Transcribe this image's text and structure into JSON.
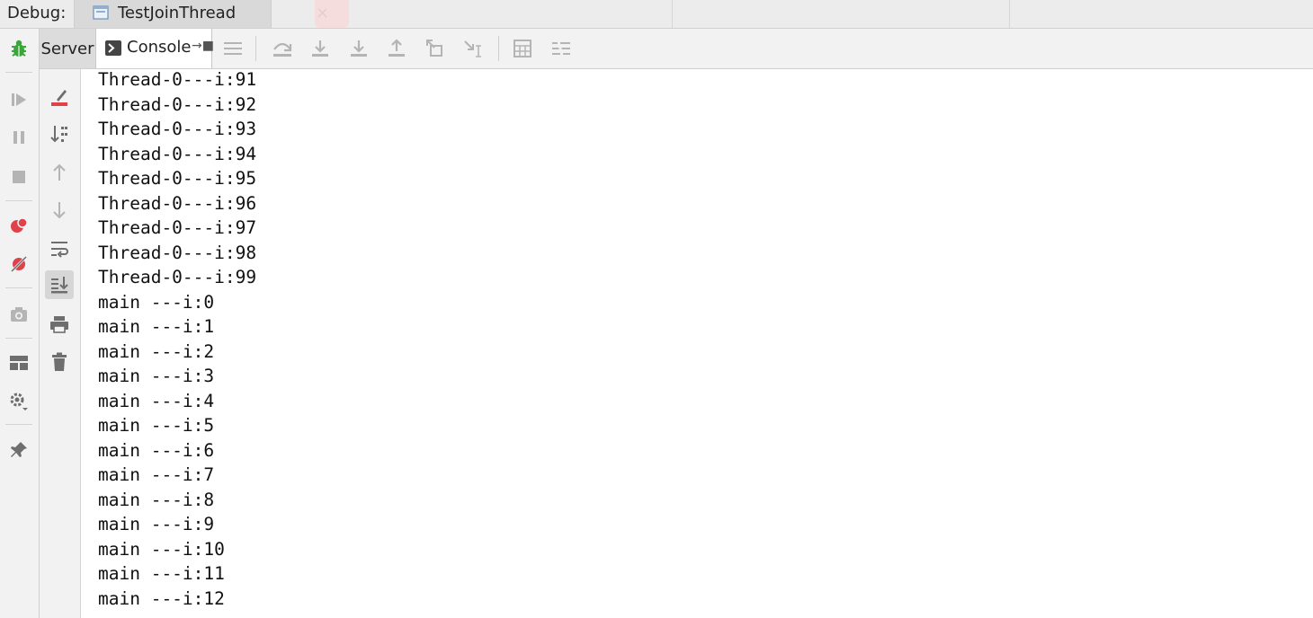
{
  "header": {
    "debug_label": "Debug:",
    "tab_label": "TestJoinThread",
    "tab_close": "×"
  },
  "toolbar": {
    "server_tab": "Server",
    "console_tab": "Console",
    "console_pin": "→■"
  },
  "console": {
    "lines": [
      "Thread-0---i:91",
      "Thread-0---i:92",
      "Thread-0---i:93",
      "Thread-0---i:94",
      "Thread-0---i:95",
      "Thread-0---i:96",
      "Thread-0---i:97",
      "Thread-0---i:98",
      "Thread-0---i:99",
      "main ---i:0",
      "main ---i:1",
      "main ---i:2",
      "main ---i:3",
      "main ---i:4",
      "main ---i:5",
      "main ---i:6",
      "main ---i:7",
      "main ---i:8",
      "main ---i:9",
      "main ---i:10",
      "main ---i:11",
      "main ---i:12"
    ]
  },
  "colors": {
    "bug_green": "#3aa63a",
    "breakpoint_red": "#e0424a",
    "icon_gray": "#6e6e6e",
    "icon_disabled": "#b4b4b4"
  }
}
